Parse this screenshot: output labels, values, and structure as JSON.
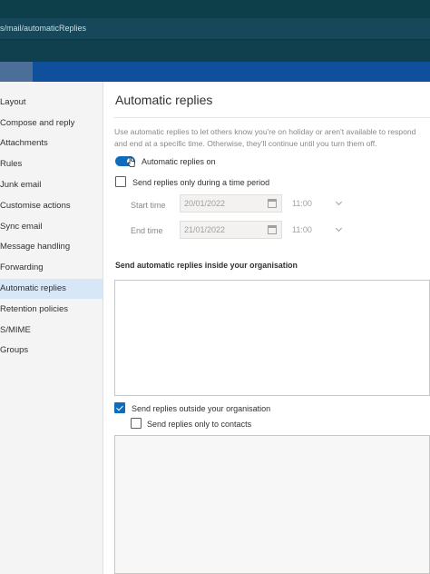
{
  "browser": {
    "url_fragment": "s/mail/automaticReplies"
  },
  "sidebar": {
    "items": [
      {
        "label": "Layout",
        "active": false
      },
      {
        "label": "Compose and reply",
        "active": false
      },
      {
        "label": "Attachments",
        "active": false
      },
      {
        "label": "Rules",
        "active": false
      },
      {
        "label": "Junk email",
        "active": false
      },
      {
        "label": "Customise actions",
        "active": false
      },
      {
        "label": "Sync email",
        "active": false
      },
      {
        "label": "Message handling",
        "active": false
      },
      {
        "label": "Forwarding",
        "active": false
      },
      {
        "label": "Automatic replies",
        "active": true
      },
      {
        "label": "Retention policies",
        "active": false
      },
      {
        "label": "S/MIME",
        "active": false
      },
      {
        "label": "Groups",
        "active": false
      }
    ]
  },
  "main": {
    "title": "Automatic replies",
    "description_line1": "Use automatic replies to let others know you're on holiday or aren't available to respond",
    "description_line2": "and end at a specific time. Otherwise, they'll continue until you turn them off.",
    "toggle": {
      "label": "Automatic replies on",
      "on": true
    },
    "time_period": {
      "label": "Send replies only during a time period",
      "checked": false,
      "start_label": "Start time",
      "start_date": "20/01/2022",
      "start_time": "11:00",
      "end_label": "End time",
      "end_date": "21/01/2022",
      "end_time": "11:00"
    },
    "inside_section_title": "Send automatic replies inside your organisation",
    "outside": {
      "label": "Send replies outside your organisation",
      "checked": true
    },
    "contacts_only": {
      "label": "Send replies only to contacts",
      "checked": false
    }
  },
  "colors": {
    "accent": "#0f6cbd",
    "selected_nav": "#d7e7f8",
    "app_bar": "#0f4f9c"
  }
}
